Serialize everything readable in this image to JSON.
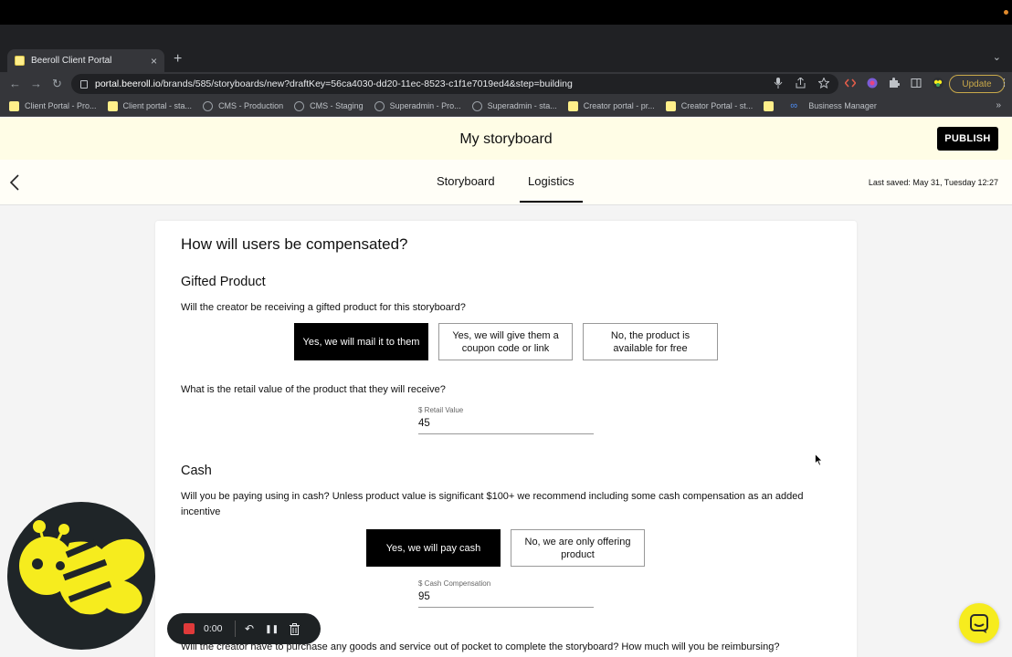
{
  "browser": {
    "tab_title": "Beeroll Client Portal",
    "tab_close": "×",
    "new_tab": "+",
    "tab_menu": "⌄",
    "back": "←",
    "forward": "→",
    "reload": "↻",
    "url_host": "portal.beeroll.io",
    "url_path": "/brands/585/storyboards/new?draftKey=56ca4030-dd20-11ec-8523-c1f1e7019ed4&step=building",
    "update_label": "Update",
    "more": "⋮",
    "bookmarks": [
      {
        "label": "Client Portal - Pro...",
        "icon": "yellow-square"
      },
      {
        "label": "Client portal - sta...",
        "icon": "yellow-square"
      },
      {
        "label": "CMS - Production",
        "icon": "globe"
      },
      {
        "label": "CMS - Staging",
        "icon": "globe"
      },
      {
        "label": "Superadmin - Pro...",
        "icon": "globe"
      },
      {
        "label": "Superadmin - sta...",
        "icon": "globe"
      },
      {
        "label": "Creator portal - pr...",
        "icon": "yellow-square"
      },
      {
        "label": "Creator Portal - st...",
        "icon": "yellow-square"
      },
      {
        "label": "",
        "icon": "yellow-square"
      },
      {
        "label": "Business Manager",
        "icon": "meta"
      }
    ],
    "bookmarks_more": "»"
  },
  "header": {
    "title": "My storyboard",
    "publish_label": "PUBLISH",
    "back_arrow": "‹",
    "tabs": [
      "Storyboard",
      "Logistics"
    ],
    "active_tab": "Logistics",
    "last_saved": "Last saved: May 31, Tuesday 12:27"
  },
  "form": {
    "heading": "How will users be compensated?",
    "gifted": {
      "title": "Gifted Product",
      "question": "Will the creator be receiving a gifted product for this storyboard?",
      "options": [
        "Yes, we will mail it to them",
        "Yes, we will give them a coupon code or link",
        "No, the product is available for free"
      ],
      "selected_index": 0,
      "retail_question": "What is the retail value of the product that they will receive?",
      "retail_label": "$ Retail Value",
      "retail_value": "45"
    },
    "cash": {
      "title": "Cash",
      "question": "Will you be paying using in cash? Unless product value is significant $100+ we recommend including some cash compensation as an added incentive",
      "options": [
        "Yes, we will pay cash",
        "No, we are only offering product"
      ],
      "selected_index": 0,
      "cash_label": "$ Cash Compensation",
      "cash_value": "95"
    },
    "reimburse_question": "Will the creator have to purchase any goods and service out of pocket to complete the storyboard? How much will you be reimbursing?"
  },
  "recorder": {
    "time": "0:00",
    "undo": "↶",
    "pause": "❚❚",
    "delete": "🗑"
  },
  "colors": {
    "header_bg": "#fffde6",
    "accent_yellow": "#f6ec1e",
    "selected_option_bg": "#000000"
  }
}
